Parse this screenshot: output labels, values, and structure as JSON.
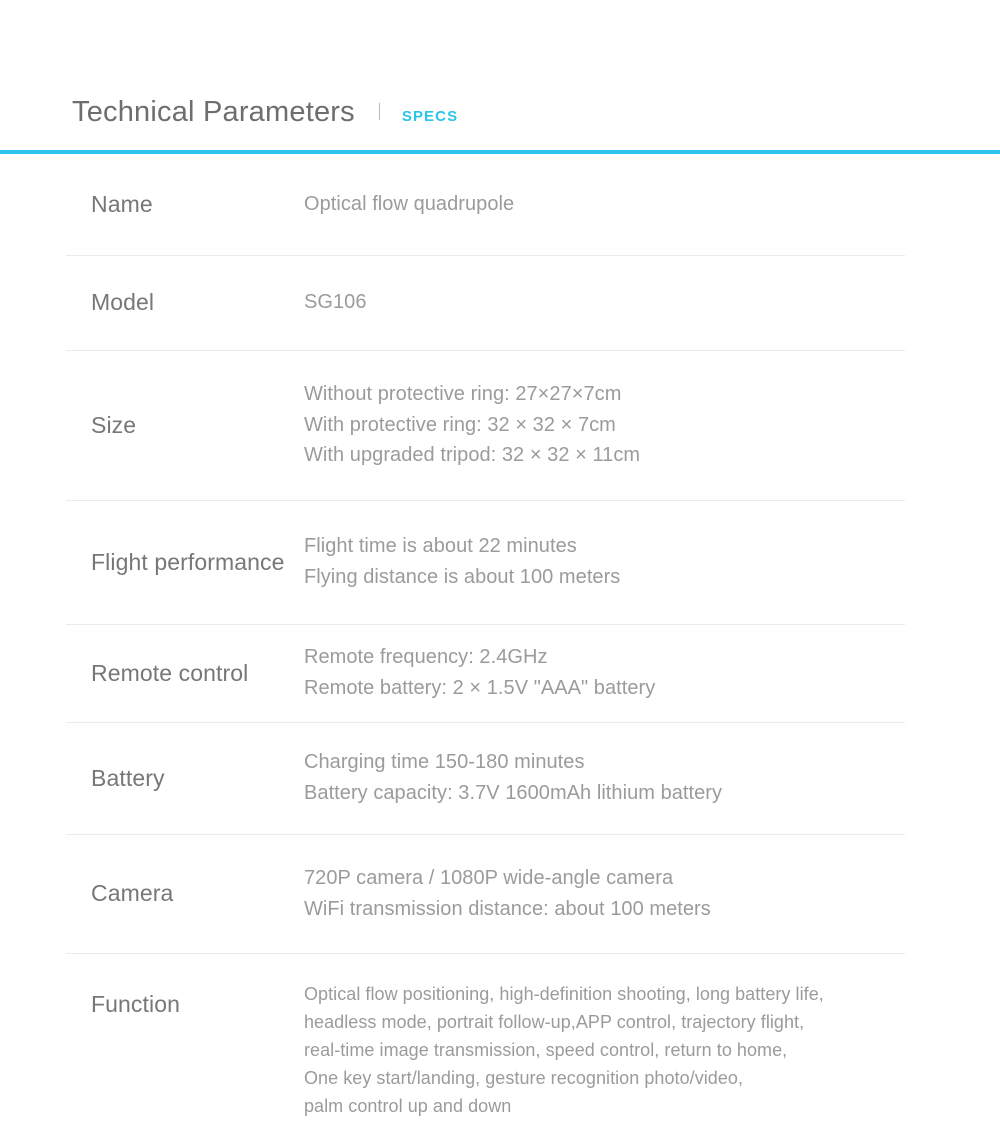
{
  "header": {
    "title": "Technical Parameters",
    "subtitle": "SPECS",
    "accent_color": "#29c5ea",
    "separator": "|"
  },
  "colors": {
    "accent": "#29c5ea",
    "label_text": "#777777",
    "value_text": "#9b9b9b",
    "title_text": "#6e6e6e",
    "divider": "#ebebeb",
    "background": "#ffffff"
  },
  "spec_table": {
    "rows": [
      {
        "label": "Name",
        "lines": [
          "Optical flow quadrupole"
        ]
      },
      {
        "label": "Model",
        "lines": [
          "SG106"
        ]
      },
      {
        "label": "Size",
        "lines": [
          "Without protective ring: 27×27×7cm",
          "With protective ring: 32 × 32 × 7cm",
          "With upgraded tripod: 32 × 32 × 11cm"
        ]
      },
      {
        "label": "Flight performance",
        "lines": [
          "Flight time is about 22 minutes",
          "Flying distance is about 100 meters"
        ]
      },
      {
        "label": "Remote control",
        "lines": [
          "Remote frequency: 2.4GHz",
          "Remote battery: 2 × 1.5V \"AAA\" battery"
        ]
      },
      {
        "label": "Battery",
        "lines": [
          "Charging time 150-180 minutes",
          "Battery capacity: 3.7V 1600mAh lithium battery"
        ]
      },
      {
        "label": "Camera",
        "lines": [
          "720P camera / 1080P wide-angle camera",
          "WiFi transmission distance: about 100 meters"
        ]
      },
      {
        "label": "Function",
        "lines": [
          "Optical flow positioning, high-definition shooting, long battery life,",
          "headless mode, portrait follow-up,APP control, trajectory flight,",
          "real-time image transmission, speed control, return to home,",
          "One key start/landing, gesture recognition photo/video,",
          "palm control up and down"
        ]
      }
    ]
  }
}
